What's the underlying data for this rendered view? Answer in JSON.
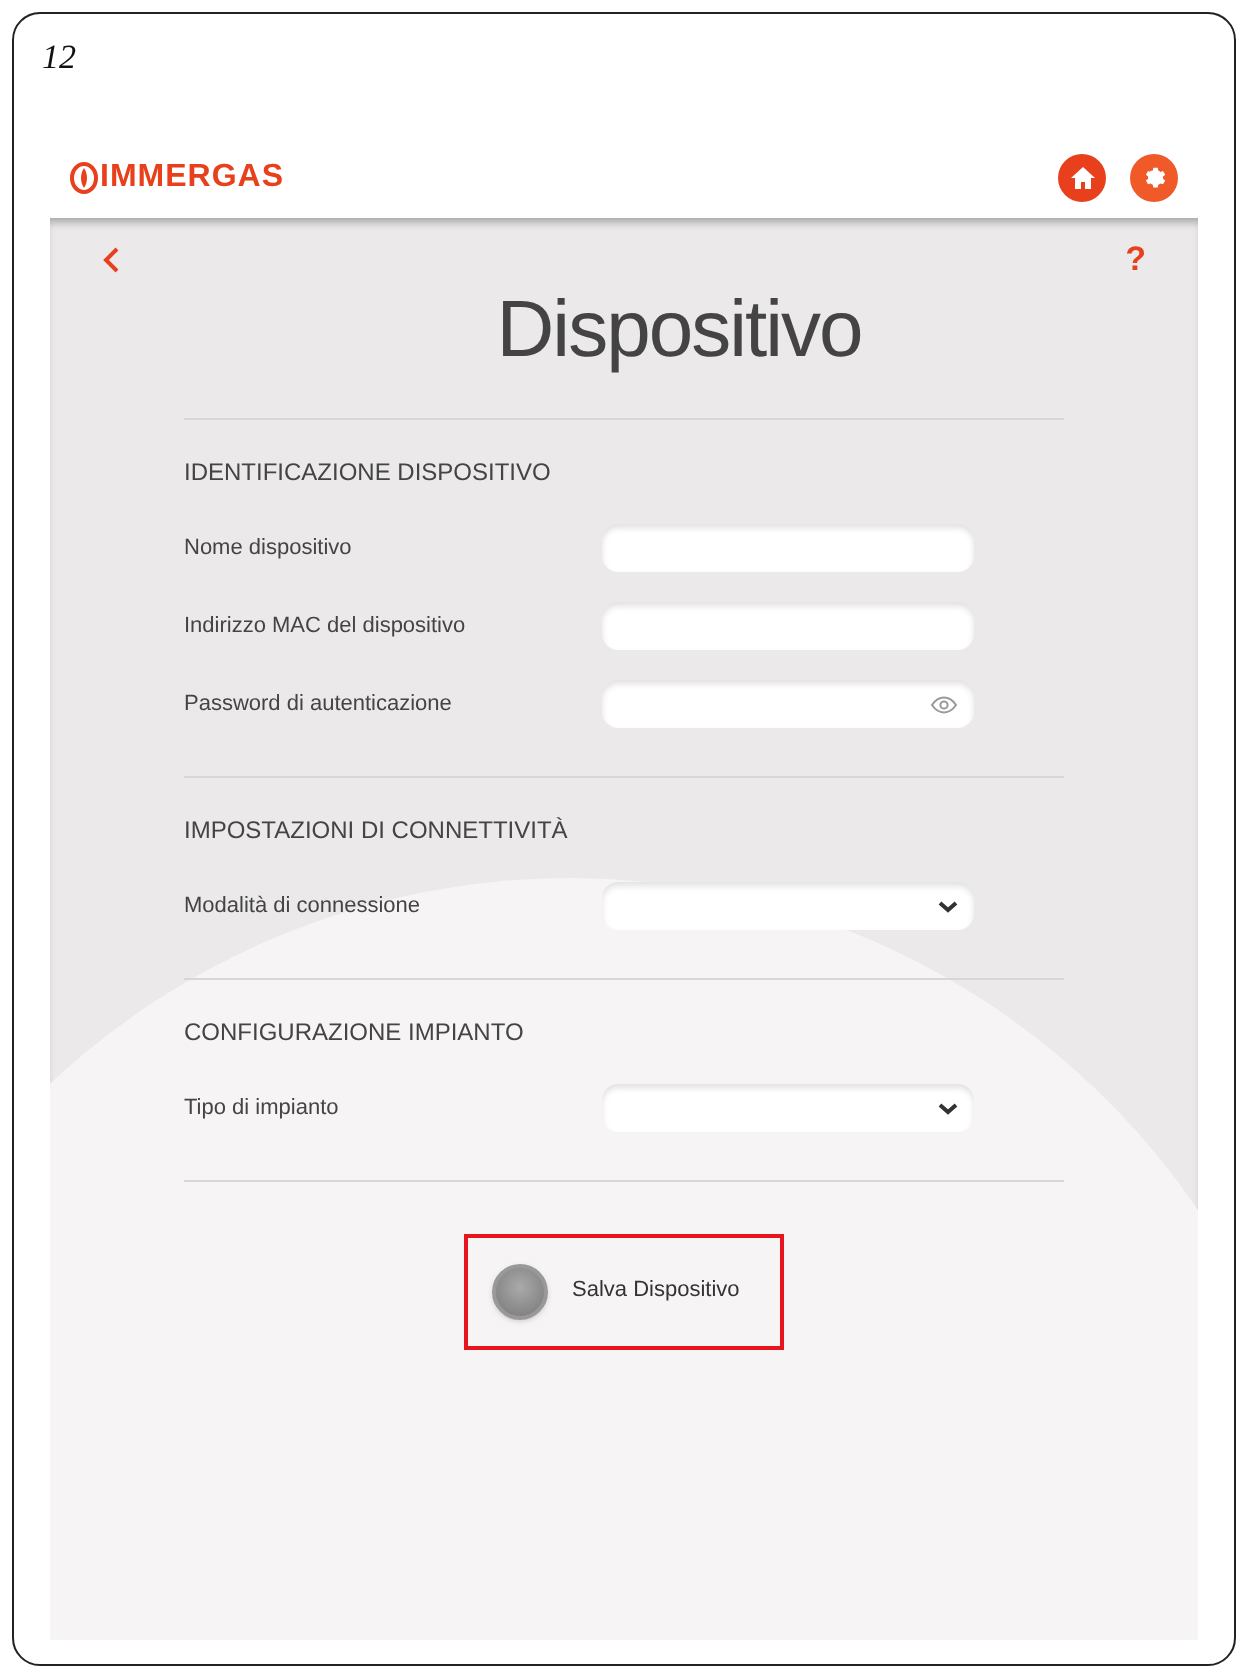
{
  "figure_number": "12",
  "brand": {
    "logo_text": "IMMERGAS"
  },
  "page": {
    "title": "Dispositivo",
    "help": "?"
  },
  "sections": [
    {
      "heading": "IDENTIFICAZIONE DISPOSITIVO",
      "fields": [
        {
          "label": "Nome dispositivo",
          "kind": "text"
        },
        {
          "label": "Indirizzo MAC del dispositivo",
          "kind": "text"
        },
        {
          "label": "Password di autenticazione",
          "kind": "password"
        }
      ]
    },
    {
      "heading": "IMPOSTAZIONI DI CONNETTIVITÀ",
      "fields": [
        {
          "label": "Modalità di connessione",
          "kind": "select"
        }
      ]
    },
    {
      "heading": "CONFIGURAZIONE IMPIANTO",
      "fields": [
        {
          "label": "Tipo di impianto",
          "kind": "select"
        }
      ]
    }
  ],
  "save": {
    "label": "Salva Dispositivo",
    "highlighted": true
  }
}
